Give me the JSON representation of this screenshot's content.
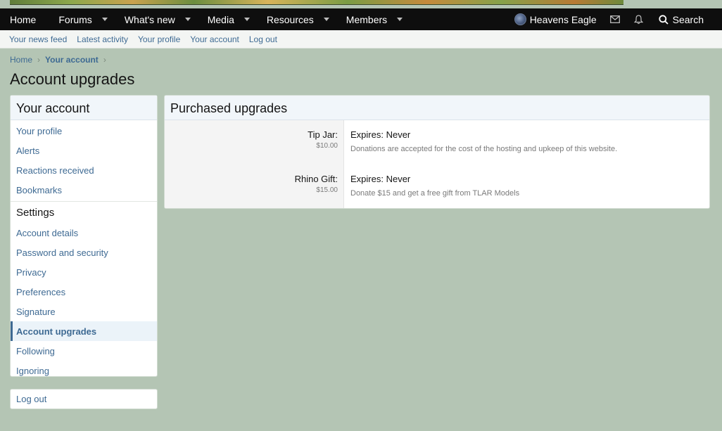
{
  "nav": {
    "items": [
      {
        "label": "Home",
        "has_menu": false
      },
      {
        "label": "Forums",
        "has_menu": true
      },
      {
        "label": "What's new",
        "has_menu": true
      },
      {
        "label": "Media",
        "has_menu": true
      },
      {
        "label": "Resources",
        "has_menu": true
      },
      {
        "label": "Members",
        "has_menu": true
      }
    ],
    "username": "Heavens Eagle",
    "search_label": "Search"
  },
  "subnav": {
    "links": [
      "Your news feed",
      "Latest activity",
      "Your profile",
      "Your account",
      "Log out"
    ]
  },
  "breadcrumb": {
    "home": "Home",
    "account": "Your account",
    "sep": "›"
  },
  "page": {
    "title": "Account upgrades"
  },
  "sidebar": {
    "title": "Your account",
    "group1": [
      "Your profile",
      "Alerts",
      "Reactions received",
      "Bookmarks"
    ],
    "settings_title": "Settings",
    "group2": [
      "Account details",
      "Password and security",
      "Privacy",
      "Preferences",
      "Signature",
      "Account upgrades",
      "Following",
      "Ignoring"
    ],
    "active": "Account upgrades",
    "logout": "Log out"
  },
  "main": {
    "title": "Purchased upgrades",
    "upgrades": [
      {
        "title": "Tip Jar:",
        "price": "$10.00",
        "expires": "Expires: Never",
        "description": "Donations are accepted for the cost of the hosting and upkeep of this website."
      },
      {
        "title": "Rhino Gift:",
        "price": "$15.00",
        "expires": "Expires: Never",
        "description": "Donate $15 and get a free gift from TLAR Models"
      }
    ]
  },
  "colors": {
    "background": "#b4c5b4",
    "link": "#3e6a93",
    "navbar": "#0e0e0e"
  },
  "icons": [
    "caret-down-icon",
    "avatar",
    "envelope-icon",
    "bell-icon",
    "search-icon",
    "chevron-right-icon"
  ]
}
